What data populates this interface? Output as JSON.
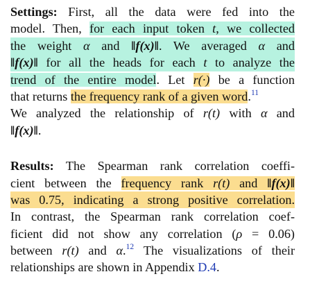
{
  "settings": {
    "heading": "Settings:",
    "l1_rest": "First, all the data were fed into the",
    "l2_a": "model. Then, ",
    "l2_b": "for each input token ",
    "l2_var": "t",
    "l2_c": ", we collected",
    "l3_a": "the weight ",
    "l3_alpha": "α",
    "l3_b": " and ",
    "l3_norm": "‖f(x)‖",
    "l3_c": ".",
    "l3_d": " We averaged ",
    "l3_alpha2": "α",
    "l3_e": " and",
    "l4_norm": "‖f(x)‖",
    "l4_a": " for all the heads for each ",
    "l4_var": "t",
    "l4_b": " to analyze the",
    "l5_a": "trend of the entire model",
    "l5_b": ". Let ",
    "l5_r": "r(·)",
    "l5_c": " be a function",
    "l6_a": "that returns ",
    "l6_b": "the frequency rank of a given word",
    "l6_c": ".",
    "l6_fn": "11",
    "l7_a": "We analyzed the relationship of ",
    "l7_rt": "r(t)",
    "l7_b": " with ",
    "l7_alpha": "α",
    "l7_c": " and",
    "l8_norm": "‖f(x)‖",
    "l8_end": "."
  },
  "results": {
    "heading": "Results:",
    "l1_rest": "The Spearman rank correlation coeffi-",
    "l2_a": "cient between the ",
    "l2_b": "frequency rank ",
    "l2_rt": "r(t)",
    "l2_c": " and ",
    "l2_norm": "‖f(x)‖",
    "l3_a": "was 0.75, indicating a strong positive correlation.",
    "l4": "In contrast, the Spearman rank correlation coef-",
    "l5_a": "ficient did not show any correlation (",
    "l5_rho": "ρ",
    "l5_b": " = 0.06)",
    "l6_a": "between ",
    "l6_rt": "r(t)",
    "l6_b": " and ",
    "l6_alpha": "α",
    "l6_c": ".",
    "l6_fn": "12",
    "l6_d": " The visualizations of their",
    "l7_a": "relationships are shown in Appendix ",
    "l7_ref": "D.4",
    "l7_b": "."
  },
  "colors": {
    "highlight_green": "#b7f2e0",
    "highlight_yellow": "#fbdd90",
    "link": "#1f3bb3"
  }
}
